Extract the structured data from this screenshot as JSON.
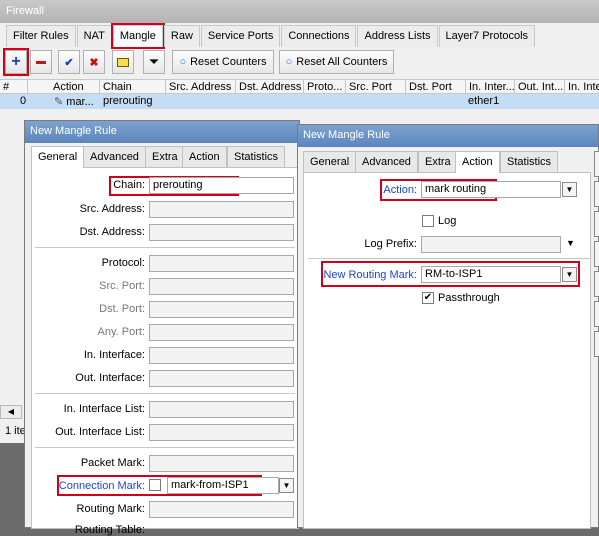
{
  "window": {
    "title": "Firewall"
  },
  "tabs": [
    "Filter Rules",
    "NAT",
    "Mangle",
    "Raw",
    "Service Ports",
    "Connections",
    "Address Lists",
    "Layer7 Protocols"
  ],
  "toolbar": {
    "reset_counters": "Reset Counters",
    "reset_all_counters": "Reset All Counters"
  },
  "table": {
    "columns": [
      "#",
      "Action",
      "Chain",
      "Src. Address",
      "Dst. Address",
      "Proto...",
      "Src. Port",
      "Dst. Port",
      "In. Inter...",
      "Out. Int...",
      "In. Inte"
    ],
    "row": {
      "num": "0",
      "action": "mar...",
      "chain": "prerouting",
      "in_interface": "ether1"
    },
    "footer": "1 ite"
  },
  "left_dialog": {
    "title": "New Mangle Rule",
    "tabs": [
      "General",
      "Advanced",
      "Extra",
      "Action",
      "Statistics"
    ],
    "fields": {
      "chain_label": "Chain:",
      "chain_value": "prerouting",
      "src_address": "Src. Address:",
      "dst_address": "Dst. Address:",
      "protocol": "Protocol:",
      "src_port": "Src. Port:",
      "dst_port": "Dst. Port:",
      "any_port": "Any. Port:",
      "in_interface": "In. Interface:",
      "out_interface": "Out. Interface:",
      "in_interface_list": "In. Interface List:",
      "out_interface_list": "Out. Interface List:",
      "packet_mark": "Packet Mark:",
      "connection_mark_label": "Connection Mark:",
      "connection_mark_value": "mark-from-ISP1",
      "routing_mark": "Routing Mark:",
      "routing_table": "Routing Table:"
    }
  },
  "right_dialog": {
    "title": "New Mangle Rule",
    "tabs": [
      "General",
      "Advanced",
      "Extra",
      "Action",
      "Statistics"
    ],
    "fields": {
      "action_label": "Action:",
      "action_value": "mark routing",
      "log_label": "Log",
      "log_prefix": "Log Prefix:",
      "new_routing_mark_label": "New Routing Mark:",
      "new_routing_mark_value": "RM-to-ISP1",
      "passthrough_label": "Passthrough"
    }
  },
  "colors": {
    "highlight": "#d0001a",
    "selected_row": "#c5dcf5",
    "title_bar": "#5b86bd",
    "link_blue": "#1d45c9"
  }
}
